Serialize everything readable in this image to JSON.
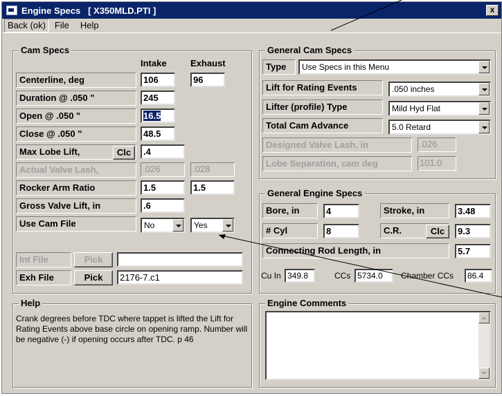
{
  "window": {
    "title": "Engine Specs   [ X350MLD.PTI ]",
    "close_label": "x"
  },
  "menu": {
    "back": "Back (ok)",
    "file": "File",
    "help": "Help"
  },
  "cam_specs": {
    "title": "Cam Specs",
    "col_intake": "Intake",
    "col_exhaust": "Exhaust",
    "centerline_label": "Centerline, deg",
    "centerline_intake": "106",
    "centerline_exhaust": "96",
    "duration_label": "Duration @ .050 \"",
    "duration_intake": "245",
    "open_label": "Open @ .050 \"",
    "open_intake": "16.5",
    "close_label": "Close @ .050 \"",
    "close_intake": "48.5",
    "max_lobe_label": "Max Lobe Lift,",
    "max_lobe_clc": "Clc",
    "max_lobe_intake": ".4",
    "actual_lash_label": "Actual Valve Lash,",
    "actual_lash_intake": ".026",
    "actual_lash_exhaust": ".028",
    "rocker_label": "Rocker Arm Ratio",
    "rocker_intake": "1.5",
    "rocker_exhaust": "1.5",
    "gross_lift_label": "Gross Valve Lift, in",
    "gross_lift_intake": ".6",
    "use_cam_label": "Use Cam File",
    "use_cam_intake": "No",
    "use_cam_exhaust": "Yes",
    "int_file_label": "Int File",
    "int_file_pick": "Pick",
    "int_file_value": "",
    "exh_file_label": "Exh File",
    "exh_file_pick": "Pick",
    "exh_file_value": "2176-7.c1"
  },
  "general_cam": {
    "title": "General Cam Specs",
    "type_label": "Type",
    "type_value": "Use Specs in this Menu",
    "rating_label": "Lift for Rating Events",
    "rating_value": ".050 inches",
    "lifter_label": "Lifter (profile) Type",
    "lifter_value": "Mild Hyd Flat",
    "advance_label": "Total Cam Advance",
    "advance_value": "5.0 Retard",
    "designed_lash_label": "Designed Valve Lash, in",
    "designed_lash_value": ".026",
    "lobe_sep_label": "Lobe Separation, cam deg",
    "lobe_sep_value": "101.0"
  },
  "general_engine": {
    "title": "General Engine Specs",
    "bore_label": "Bore, in",
    "bore_value": "4",
    "stroke_label": "Stroke, in",
    "stroke_value": "3.48",
    "cyl_label": "# Cyl",
    "cyl_value": "8",
    "cr_label": "C.R.",
    "cr_clc": "Clc",
    "cr_value": "9.3",
    "rod_label": "Connecting Rod Length, in",
    "rod_value": "5.7",
    "cuin_label": "Cu In",
    "cuin_value": "349.8",
    "ccs_label": "CCs",
    "ccs_value": "5734.0",
    "chamber_label": "Chamber CCs",
    "chamber_value": "86.4"
  },
  "help": {
    "title": "Help",
    "text": "Crank degrees before TDC where tappet is lifted the Lift for Rating Events above base circle on opening ramp.  Number will be negative (-) if opening occurs after TDC.  p 46"
  },
  "comments": {
    "title": "Engine Comments",
    "value": ""
  }
}
